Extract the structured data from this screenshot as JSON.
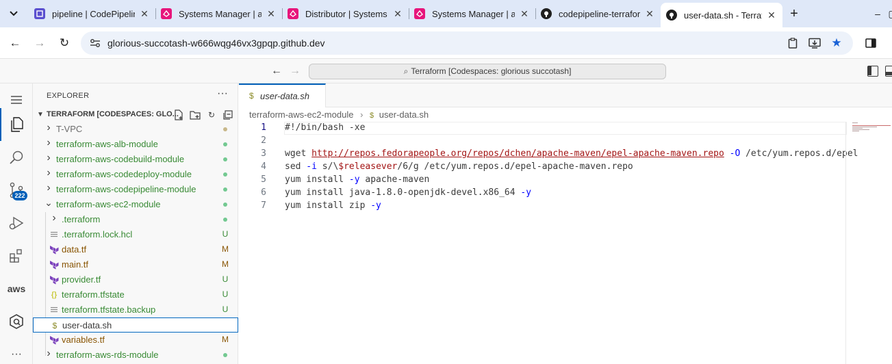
{
  "browser": {
    "tabs": [
      {
        "title": "pipeline | CodePipeline",
        "favicon": "codepipeline-icon",
        "color": "#5a4fcf"
      },
      {
        "title": "Systems Manager | ap",
        "favicon": "systems-manager-icon",
        "color": "#e7157b"
      },
      {
        "title": "Distributor | Systems",
        "favicon": "systems-manager-icon",
        "color": "#e7157b"
      },
      {
        "title": "Systems Manager | ap",
        "favicon": "systems-manager-icon",
        "color": "#e7157b"
      },
      {
        "title": "codepipeline-terrafor",
        "favicon": "github-icon",
        "color": "#1f1f1f"
      },
      {
        "title": "user-data.sh - Terrafor",
        "favicon": "github-icon",
        "color": "#1f1f1f",
        "active": true
      }
    ],
    "address": "glorious-succotash-w666wqg46vx3gpqp.github.dev"
  },
  "vscode": {
    "command_center": "Terraform [Codespaces: glorious succotash]",
    "scm_badge": "222",
    "explorer": {
      "header": "EXPLORER",
      "more": "···",
      "section_title": "TERRAFORM [CODESPACES: GLO...",
      "items": [
        {
          "label": "T-VPC",
          "kind": "folder",
          "expanded": false,
          "depth": 0,
          "status": "dot",
          "status_color": "#c8b88a",
          "label_color": "#6c6c6c"
        },
        {
          "label": "terraform-aws-alb-module",
          "kind": "folder",
          "expanded": false,
          "depth": 0,
          "status": "dot",
          "status_color": "#73c991",
          "label_color": "#388a34"
        },
        {
          "label": "terraform-aws-codebuild-module",
          "kind": "folder",
          "expanded": false,
          "depth": 0,
          "status": "dot",
          "status_color": "#73c991",
          "label_color": "#388a34"
        },
        {
          "label": "terraform-aws-codedeploy-module",
          "kind": "folder",
          "expanded": false,
          "depth": 0,
          "status": "dot",
          "status_color": "#73c991",
          "label_color": "#388a34"
        },
        {
          "label": "terraform-aws-codepipeline-module",
          "kind": "folder",
          "expanded": false,
          "depth": 0,
          "status": "dot",
          "status_color": "#73c991",
          "label_color": "#388a34"
        },
        {
          "label": "terraform-aws-ec2-module",
          "kind": "folder",
          "expanded": true,
          "depth": 0,
          "status": "dot",
          "status_color": "#73c991",
          "label_color": "#388a34"
        },
        {
          "label": ".terraform",
          "kind": "folder",
          "expanded": false,
          "depth": 1,
          "status": "dot",
          "status_color": "#73c991",
          "label_color": "#388a34"
        },
        {
          "label": ".terraform.lock.hcl",
          "kind": "lines",
          "depth": 1,
          "status": "U",
          "status_color": "#388a34",
          "label_color": "#388a34"
        },
        {
          "label": "data.tf",
          "kind": "terraform",
          "depth": 1,
          "status": "M",
          "status_color": "#895503",
          "label_color": "#895503"
        },
        {
          "label": "main.tf",
          "kind": "terraform",
          "depth": 1,
          "status": "M",
          "status_color": "#895503",
          "label_color": "#895503"
        },
        {
          "label": "provider.tf",
          "kind": "terraform",
          "depth": 1,
          "status": "U",
          "status_color": "#388a34",
          "label_color": "#388a34"
        },
        {
          "label": "terraform.tfstate",
          "kind": "json",
          "depth": 1,
          "status": "U",
          "status_color": "#388a34",
          "label_color": "#388a34"
        },
        {
          "label": "terraform.tfstate.backup",
          "kind": "lines",
          "depth": 1,
          "status": "U",
          "status_color": "#388a34",
          "label_color": "#388a34"
        },
        {
          "label": "user-data.sh",
          "kind": "shell",
          "depth": 1,
          "status": "",
          "status_color": "#388a34",
          "label_color": "#3b3b3b",
          "selected": true
        },
        {
          "label": "variables.tf",
          "kind": "terraform",
          "depth": 1,
          "status": "M",
          "status_color": "#895503",
          "label_color": "#895503"
        },
        {
          "label": "terraform-aws-rds-module",
          "kind": "folder",
          "expanded": false,
          "depth": 0,
          "status": "dot",
          "status_color": "#73c991",
          "label_color": "#388a34"
        }
      ]
    },
    "editor": {
      "tab_label": "user-data.sh",
      "breadcrumb_folder": "terraform-aws-ec2-module",
      "breadcrumb_file": "user-data.sh",
      "lines": [
        [
          {
            "t": "#!/bin/bash -xe",
            "c": ""
          }
        ],
        [],
        [
          {
            "t": "wget ",
            "c": ""
          },
          {
            "t": "http://repos.fedorapeople.org/repos/dchen/apache-maven/epel-apache-maven.repo",
            "c": "link"
          },
          {
            "t": " -O",
            "c": "opt"
          },
          {
            "t": " /etc/yum.repos.d/epel",
            "c": ""
          }
        ],
        [
          {
            "t": "sed",
            "c": ""
          },
          {
            "t": " -i",
            "c": "opt"
          },
          {
            "t": " s/\\",
            "c": ""
          },
          {
            "t": "$releasever",
            "c": "var"
          },
          {
            "t": "/6/g /etc/yum.repos.d/epel-apache-maven.repo",
            "c": ""
          }
        ],
        [
          {
            "t": "yum install",
            "c": ""
          },
          {
            "t": " -y",
            "c": "opt"
          },
          {
            "t": " apache-maven",
            "c": ""
          }
        ],
        [
          {
            "t": "yum install java-1.8.0-openjdk-devel.x86_64",
            "c": ""
          },
          {
            "t": " -y",
            "c": "opt"
          }
        ],
        [
          {
            "t": "yum install zip",
            "c": ""
          },
          {
            "t": " -y",
            "c": "opt"
          }
        ]
      ]
    }
  }
}
